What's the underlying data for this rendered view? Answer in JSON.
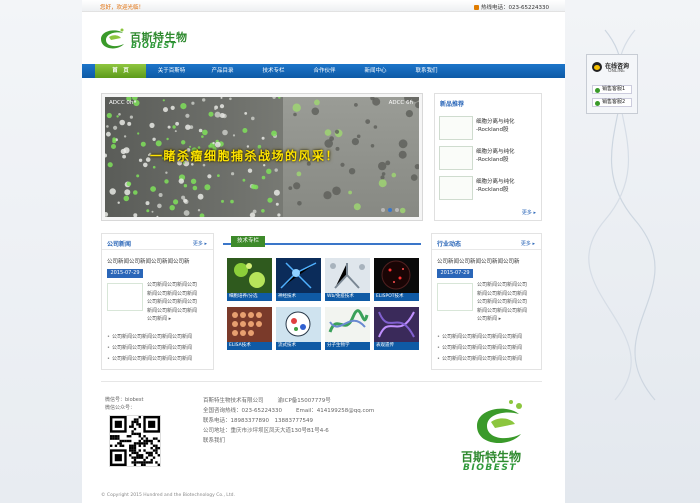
{
  "topbar": {
    "welcome": "您好，欢迎光临！",
    "hotline": "热线电话：023-65224330"
  },
  "logo": {
    "cn": "百斯特生物",
    "en": "BIOBEST"
  },
  "nav": {
    "items": [
      "首　页",
      "关于百斯特",
      "产品目录",
      "技术专栏",
      "合作伙伴",
      "新闻中心",
      "联系我们"
    ]
  },
  "banner": {
    "label_left": "ADCC 0h",
    "label_right": "ADCC 6h",
    "headline": "一睹杀瘤细胞捕杀战场的风采！"
  },
  "new_products": {
    "title": "新品推荐",
    "more": "更多 ▸",
    "items": [
      {
        "line1": "细胞分离与纯化",
        "line2": "-Rockland股"
      },
      {
        "line1": "细胞分离与纯化",
        "line2": "-Rockland股"
      },
      {
        "line1": "细胞分离与纯化",
        "line2": "-Rockland股"
      }
    ]
  },
  "company_news": {
    "title": "公司新闻",
    "more": "更多 ▸",
    "headline": "公司新闻公司新闻公司新闻公司新",
    "date": "2015-07-29",
    "body": [
      "公司新闻公司新闻公司",
      "新闻公司新闻公司新闻",
      "公司新闻公司新闻公司",
      "新闻公司新闻公司新闻",
      "公司新闻 ▸"
    ],
    "list": [
      "公司新闻公司新闻公司新闻公司新闻",
      "公司新闻公司新闻公司新闻公司新闻",
      "公司新闻公司新闻公司新闻公司新闻"
    ]
  },
  "tech": {
    "title": "技术专栏",
    "items": [
      "细胞培养/分选",
      "神经技术",
      "Wb/免疫技术",
      "ELISPOT技术",
      "ELISA技术",
      "流式技术",
      "分子生物学",
      "表观遗传"
    ]
  },
  "industry_news": {
    "title": "行业动态",
    "more": "更多 ▸",
    "headline": "公司新闻公司新闻公司新闻公司新",
    "date": "2015-07-29",
    "body": [
      "公司新闻公司新闻公司",
      "新闻公司新闻公司新闻",
      "公司新闻公司新闻公司",
      "新闻公司新闻公司新闻",
      "公司新闻 ▸"
    ],
    "list": [
      "公司新闻公司新闻公司新闻公司新闻",
      "公司新闻公司新闻公司新闻公司新闻",
      "公司新闻公司新闻公司新闻公司新闻"
    ]
  },
  "footer": {
    "wechat_id": "微信号：biobest",
    "wechat_account": "微信公众号：",
    "company": "百斯特生物技术有限公司",
    "icp": "渝ICP备15007779号",
    "hotline": "全国咨询热线：023-65224330",
    "email": "Email：414199258@qq.com",
    "phone": "联系电话：18983377890　13883777549",
    "address": "公司地址：重庆市沙坪坝区凤天大道130号B1号4-6",
    "contact": "联系我们",
    "copyright": "© Copyright 2015 Hundred and the Biotechnology Co., Ltd."
  },
  "service": {
    "title": "在线咨询",
    "subtitle": "ONLINE",
    "buttons": [
      "销售客服1",
      "销售客服2"
    ]
  }
}
